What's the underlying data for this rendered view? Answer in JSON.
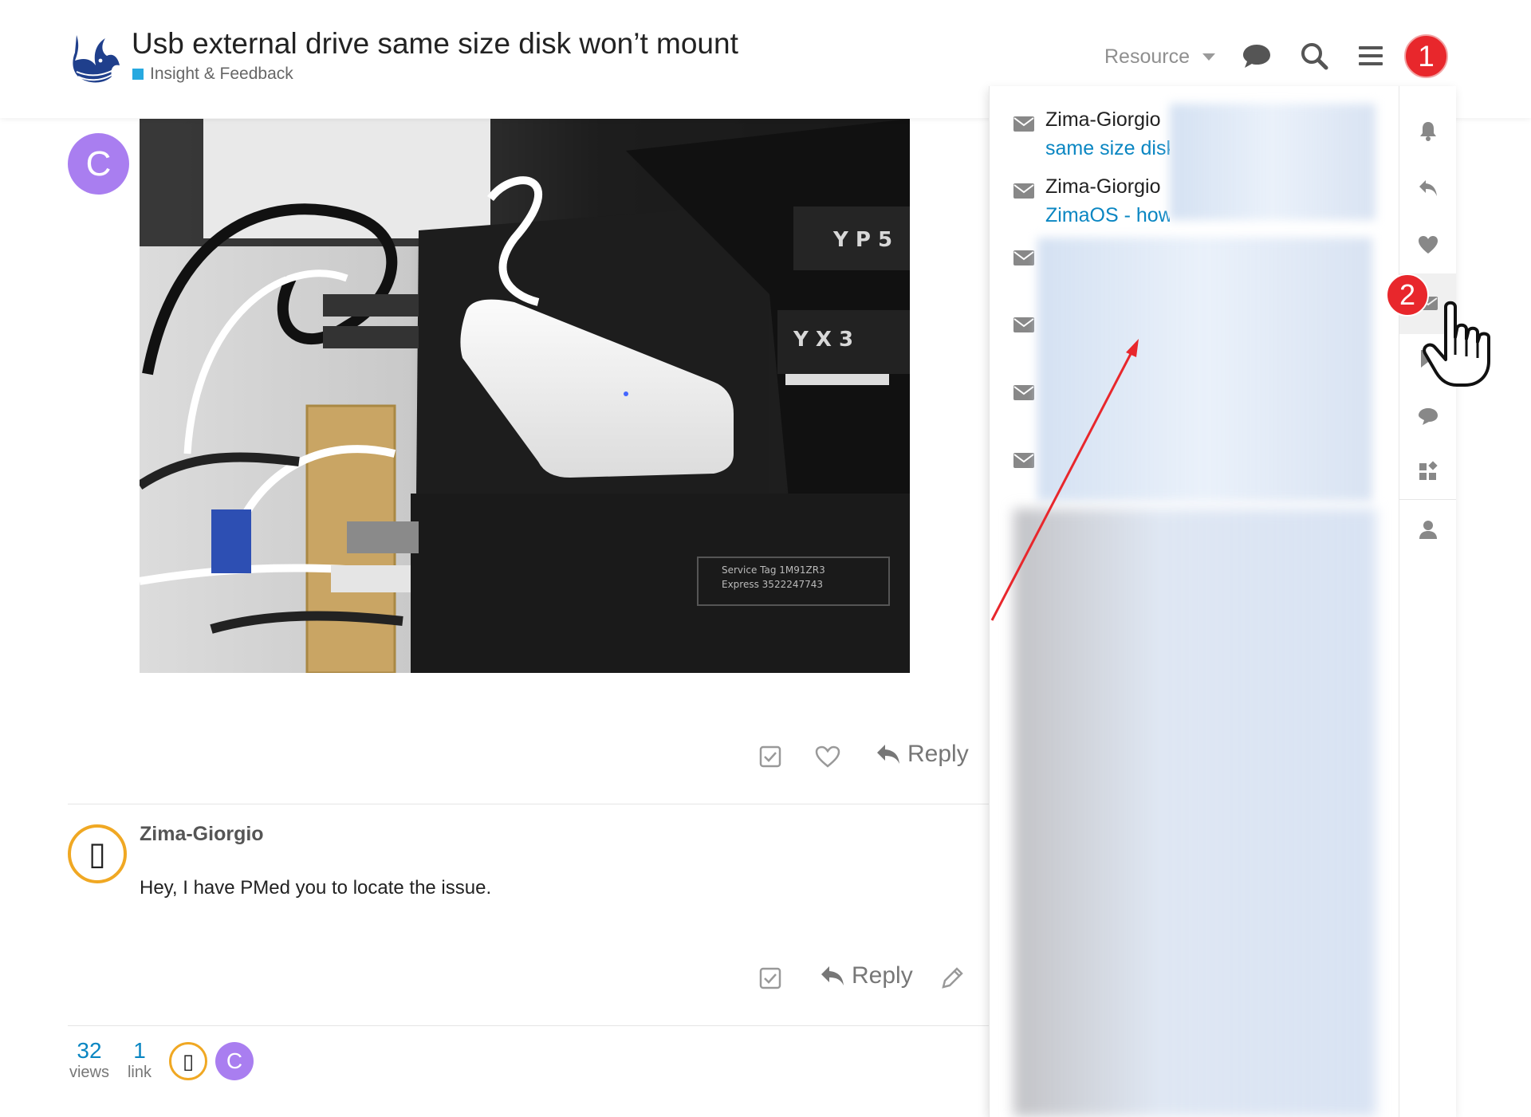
{
  "header": {
    "title": "Usb external drive same size disk won’t mount",
    "category": "Insight & Feedback",
    "category_color": "#27a9e0",
    "resource_label": "Resource",
    "notification_count": "1",
    "icons": [
      "chat-icon",
      "search-icon",
      "hamburger-menu-icon"
    ]
  },
  "post1": {
    "avatar_letter": "C",
    "avatar_color": "#a97ef0",
    "reply_label": "Reply"
  },
  "post2": {
    "username": "Zima-Giorgio",
    "avatar_glyph": "▯",
    "body": "Hey, I have PMed you to locate the issue.",
    "reply_label": "Reply"
  },
  "footer": {
    "views_count": "32",
    "views_label": "views",
    "links_count": "1",
    "links_label": "link",
    "participant_c": "C",
    "participant_z": "▯"
  },
  "messages_panel": {
    "items": [
      {
        "sender": "Zima-Giorgio",
        "subject": "same size disk"
      },
      {
        "sender": "Zima-Giorgio",
        "subject": "ZimaOS - how"
      }
    ],
    "side_icons": [
      "bell-icon",
      "reply-icon",
      "heart-icon",
      "envelope-icon",
      "bookmark-icon",
      "chat-icon",
      "apps-icon",
      "user-icon"
    ]
  },
  "annotation": {
    "step_badge": "2",
    "color": "#e8272c"
  }
}
